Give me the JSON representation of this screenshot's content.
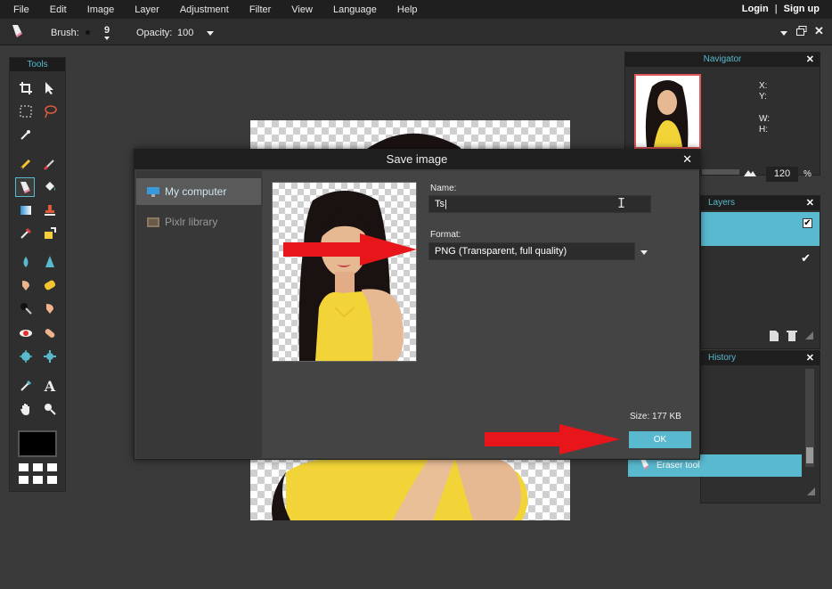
{
  "menu": [
    "File",
    "Edit",
    "Image",
    "Layer",
    "Adjustment",
    "Filter",
    "View",
    "Language",
    "Help"
  ],
  "account": {
    "login": "Login",
    "separator": "|",
    "signup": "Sign up"
  },
  "options": {
    "brush_label": "Brush:",
    "brush_size": "9",
    "opacity_label": "Opacity:",
    "opacity_value": "100"
  },
  "toolbox": {
    "title": "Tools"
  },
  "navigator": {
    "title": "Navigator",
    "x_label": "X:",
    "y_label": "Y:",
    "w_label": "W:",
    "h_label": "H:",
    "zoom": "120",
    "zoom_unit": "%"
  },
  "layers": {
    "title": "Layers"
  },
  "history": {
    "title": "History",
    "items": [
      "Eraser tool"
    ]
  },
  "dialog": {
    "title": "Save image",
    "locations": [
      "My computer",
      "Pixlr library"
    ],
    "name_label": "Name:",
    "name_value": "Ts",
    "format_label": "Format:",
    "format_value": "PNG (Transparent, full quality)",
    "size_text": "Size: 177 KB",
    "ok_label": "OK"
  },
  "colors": {
    "accent": "#59b9cf",
    "arrow": "#e8151b",
    "shirt": "#f2d438"
  }
}
